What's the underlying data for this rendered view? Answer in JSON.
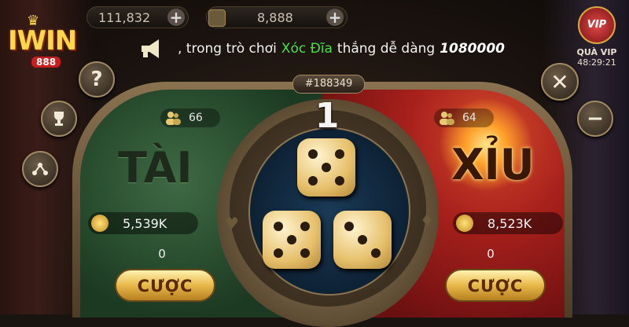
{
  "topbar": {
    "balance_gold": "111,832",
    "balance_silver": "8,888"
  },
  "logo": {
    "text": "IWIN",
    "sub": "888"
  },
  "marquee": {
    "prefix": ",  trong trò chơi",
    "game": "Xóc Đĩa",
    "suffix": "thắng dễ dàng",
    "amount": "1080000"
  },
  "vip": {
    "label": "QUÀ VIP",
    "timer": "48:29:21",
    "badge": "VIP"
  },
  "session": {
    "id": "#188349"
  },
  "countdown": "1",
  "tai": {
    "title": "TÀI",
    "players": "66",
    "total": "5,539K",
    "my_bet": "0",
    "button": "CƯỢC"
  },
  "xiu": {
    "title": "XỈU",
    "players": "64",
    "total": "8,523K",
    "my_bet": "0",
    "button": "CƯỢC"
  },
  "side_buttons_left": [
    {
      "name": "help-button",
      "icon": "?"
    },
    {
      "name": "trophy-button",
      "icon": "trophy-icon"
    },
    {
      "name": "chart-button",
      "icon": "network-icon"
    }
  ],
  "side_buttons_right": [
    {
      "name": "close-button",
      "icon": "close-icon"
    },
    {
      "name": "minimize-button",
      "icon": "minus-icon"
    }
  ],
  "dice": [
    {
      "face": 5
    },
    {
      "face": 5
    },
    {
      "face": 3
    }
  ],
  "colors": {
    "tai_green": "#2e5a36",
    "xiu_red": "#b0231c",
    "gold": "#e8b84a",
    "accent_green_text": "#4be04a"
  }
}
